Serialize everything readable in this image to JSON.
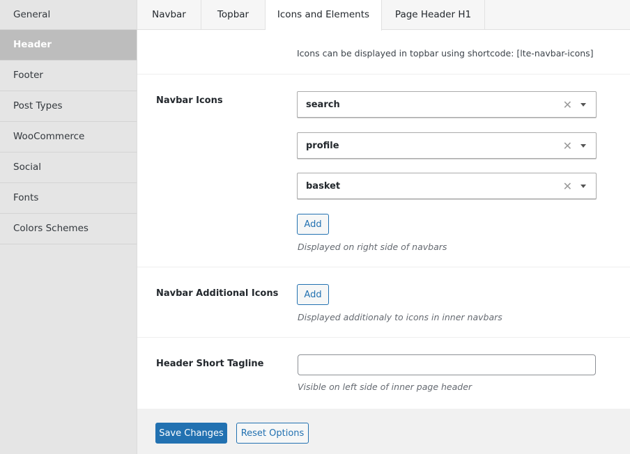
{
  "sidebar": {
    "items": [
      {
        "label": "General"
      },
      {
        "label": "Header"
      },
      {
        "label": "Footer"
      },
      {
        "label": "Post Types"
      },
      {
        "label": "WooCommerce"
      },
      {
        "label": "Social"
      },
      {
        "label": "Fonts"
      },
      {
        "label": "Colors Schemes"
      }
    ],
    "active": "Header"
  },
  "tabs": [
    {
      "label": "Navbar"
    },
    {
      "label": "Topbar"
    },
    {
      "label": "Icons and Elements"
    },
    {
      "label": "Page Header H1"
    }
  ],
  "active_tab": "Icons and Elements",
  "info_note": "Icons can be displayed in topbar using shortcode: [lte-navbar-icons]",
  "navbar_icons": {
    "label": "Navbar Icons",
    "selects": [
      {
        "value": "search",
        "clear": "✕"
      },
      {
        "value": "profile",
        "clear": "✕"
      },
      {
        "value": "basket",
        "clear": "✕"
      }
    ],
    "add_label": "Add",
    "description": "Displayed on right side of navbars"
  },
  "navbar_additional_icons": {
    "label": "Navbar Additional Icons",
    "add_label": "Add",
    "description": "Displayed additionaly to icons in inner navbars"
  },
  "header_short_tagline": {
    "label": "Header Short Tagline",
    "value": "",
    "description": "Visible on left side of inner page header"
  },
  "footer": {
    "save_label": "Save Changes",
    "reset_label": "Reset Options"
  },
  "colors": {
    "accent": "#2271b1",
    "sidebar_active": "#bdbdbd"
  }
}
